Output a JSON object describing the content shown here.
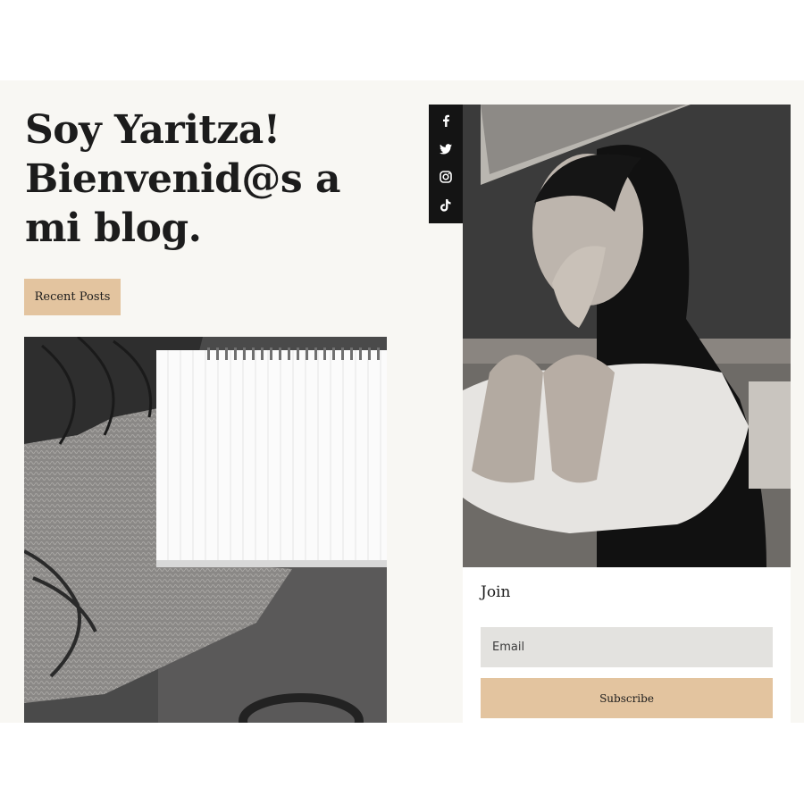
{
  "hero": {
    "title": "Soy Yaritza! Bienvenid@s a mi blog.",
    "recent_posts_label": "Recent Posts"
  },
  "social": {
    "icons": [
      "facebook-icon",
      "twitter-icon",
      "instagram-icon",
      "tiktok-icon"
    ]
  },
  "images": {
    "notebook": "notebook-photo",
    "portrait": "portrait-photo"
  },
  "join": {
    "title": "Join",
    "email_placeholder": "Email",
    "subscribe_label": "Subscribe"
  },
  "colors": {
    "background": "#f8f7f3",
    "accent": "#e3c49f",
    "social_bar": "#141414",
    "input_bg": "#e3e2df"
  }
}
